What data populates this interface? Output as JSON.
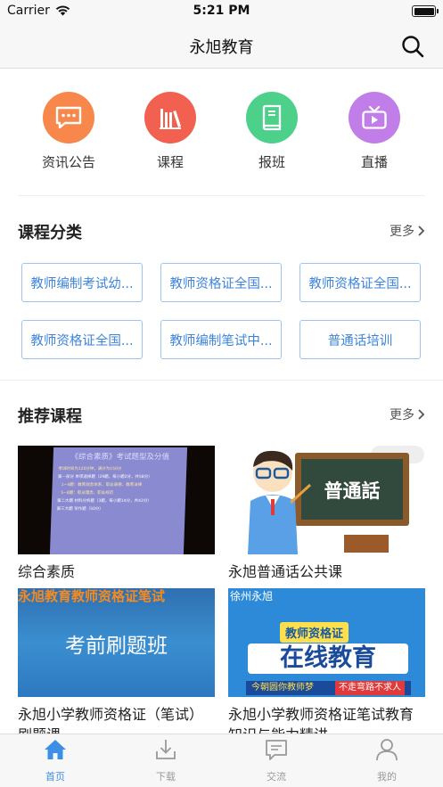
{
  "status_bar": {
    "carrier": "Carrier",
    "time": "5:21 PM"
  },
  "header": {
    "title": "永旭教育"
  },
  "quick_menu": [
    {
      "label": "资讯公告",
      "icon": "chat-bubble-icon",
      "color": "#f7874a"
    },
    {
      "label": "课程",
      "icon": "books-icon",
      "color": "#f2604f"
    },
    {
      "label": "报班",
      "icon": "book-icon",
      "color": "#4cd08a"
    },
    {
      "label": "直播",
      "icon": "tv-icon",
      "color": "#c27ee8"
    }
  ],
  "categories": {
    "title": "课程分类",
    "more": "更多",
    "items": [
      "教师编制考试幼...",
      "教师资格证全国...",
      "教师资格证全国...",
      "教师资格证全国...",
      "教师编制笔试中...",
      "普通话培训"
    ]
  },
  "recommended": {
    "title": "推荐课程",
    "more": "更多",
    "courses": [
      {
        "name": "综合素质",
        "thumb": {
          "heading": "《综合素质》考试题型及分值",
          "lines": [
            "考试时间为120分钟，满分为150分",
            "第一部分 单项选择题（29题，每小题2分，共58分）",
            "1~4题：教育观念体系、职业道德、教育法律",
            "5~8题：职业理念、职业规范",
            "第二大题 材料分析题（3题，每小题14分，共42分）",
            "第三大题 写作题（50分）"
          ]
        }
      },
      {
        "name": "永旭普通话公共课",
        "thumb": {
          "board": "普通話"
        }
      },
      {
        "name": "永旭小学教师资格证（笔试）刷题课",
        "thumb": {
          "banner": "永旭教育教师资格证笔试",
          "main": "考前刷题班"
        }
      },
      {
        "name": "永旭小学教师资格证笔试教育知识与能力精讲",
        "thumb": {
          "corner": "徐州永旭",
          "tag": "教师资格证",
          "main": "在线教育",
          "slogan_left": "今朝圆你教师梦",
          "slogan_right": "不走弯路不求人"
        }
      }
    ]
  },
  "tab_bar": {
    "active_color": "#3d8fe6",
    "inactive_color": "#999999",
    "items": [
      {
        "label": "首页",
        "icon": "home-icon",
        "active": true
      },
      {
        "label": "下载",
        "icon": "download-icon",
        "active": false
      },
      {
        "label": "交流",
        "icon": "message-icon",
        "active": false
      },
      {
        "label": "我的",
        "icon": "user-icon",
        "active": false
      }
    ]
  }
}
